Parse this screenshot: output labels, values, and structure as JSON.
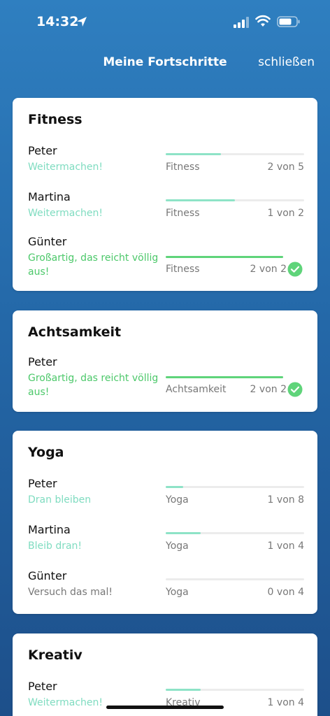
{
  "status": {
    "time": "14:32"
  },
  "nav": {
    "title": "Meine Fortschritte",
    "close_label": "schließen"
  },
  "colors": {
    "fill_teal": "#8ee3c7",
    "fill_green": "#5fd47a",
    "msg_teal": "#7fdcc0",
    "msg_green": "#4cc86a",
    "msg_gray": "#777777"
  },
  "cards": [
    {
      "title": "Fitness",
      "rows": [
        {
          "name": "Peter",
          "message": "Weitermachen!",
          "message_tone": "teal",
          "category": "Fitness",
          "count": "2 von 5",
          "progress": 0.4,
          "complete": false
        },
        {
          "name": "Martina",
          "message": "Weitermachen!",
          "message_tone": "teal",
          "category": "Fitness",
          "count": "1 von 2",
          "progress": 0.5,
          "complete": false
        },
        {
          "name": "Günter",
          "message": "Großartig, das reicht völlig aus!",
          "message_tone": "green",
          "category": "Fitness",
          "count": "2 von 2",
          "progress": 1.0,
          "complete": true
        }
      ]
    },
    {
      "title": "Achtsamkeit",
      "rows": [
        {
          "name": "Peter",
          "message": "Großartig, das reicht völlig aus!",
          "message_tone": "green",
          "category": "Achtsamkeit",
          "count": "2 von 2",
          "progress": 1.0,
          "complete": true
        }
      ]
    },
    {
      "title": "Yoga",
      "rows": [
        {
          "name": "Peter",
          "message": "Dran bleiben",
          "message_tone": "teal",
          "category": "Yoga",
          "count": "1 von 8",
          "progress": 0.125,
          "complete": false
        },
        {
          "name": "Martina",
          "message": "Bleib dran!",
          "message_tone": "teal",
          "category": "Yoga",
          "count": "1 von 4",
          "progress": 0.25,
          "complete": false
        },
        {
          "name": "Günter",
          "message": "Versuch das mal!",
          "message_tone": "gray",
          "category": "Yoga",
          "count": "0 von 4",
          "progress": 0.0,
          "complete": false
        }
      ]
    },
    {
      "title": "Kreativ",
      "rows": [
        {
          "name": "Peter",
          "message": "Weitermachen!",
          "message_tone": "teal",
          "category": "Kreativ",
          "count": "1 von 4",
          "progress": 0.25,
          "complete": false
        }
      ]
    }
  ]
}
